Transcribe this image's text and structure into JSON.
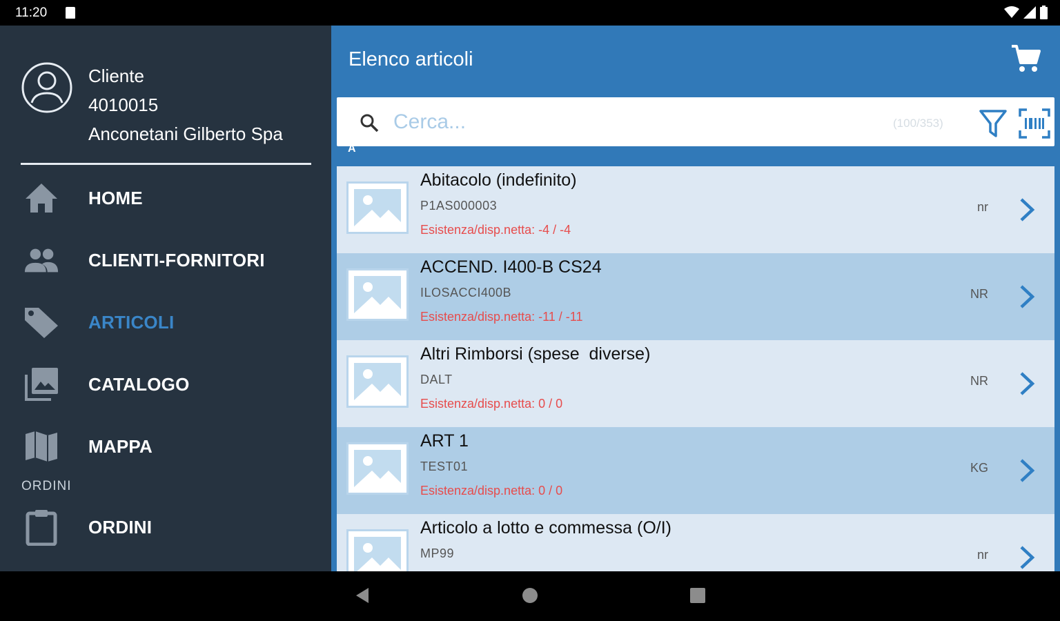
{
  "status_bar": {
    "time": "11:20"
  },
  "drawer": {
    "profile": {
      "label": "Cliente",
      "code": "4010015",
      "name": "Anconetani Gilberto Spa"
    },
    "menu": [
      {
        "label": "HOME",
        "icon": "home-icon"
      },
      {
        "label": "CLIENTI-FORNITORI",
        "icon": "people-icon"
      },
      {
        "label": "ARTICOLI",
        "icon": "tag-icon",
        "active": true
      },
      {
        "label": "CATALOGO",
        "icon": "photo-library-icon"
      },
      {
        "label": "MAPPA",
        "icon": "map-icon"
      }
    ],
    "section_ordini": "ORDINI",
    "menu_ordini": {
      "label": "ORDINI",
      "icon": "clipboard-icon"
    }
  },
  "app_bar": {
    "title": "Elenco articoli"
  },
  "search": {
    "placeholder": "Cerca...",
    "count": "(100/353)"
  },
  "section_letter": "A",
  "items": [
    {
      "title": "Abitacolo (indefinito)",
      "code": "P1AS000003",
      "stock": "Esistenza/disp.netta: -4 / -4",
      "unit": "nr"
    },
    {
      "title": "ACCEND. I400-B CS24",
      "code": "ILOSACCI400B",
      "stock": "Esistenza/disp.netta: -11 / -11",
      "unit": "NR"
    },
    {
      "title": "Altri Rimborsi (spese  diverse)",
      "code": "DALT",
      "stock": "Esistenza/disp.netta: 0 / 0",
      "unit": "NR"
    },
    {
      "title": "ART 1",
      "code": "TEST01",
      "stock": "Esistenza/disp.netta: 0 / 0",
      "unit": "KG"
    },
    {
      "title": "Articolo a lotto e commessa (O/I)",
      "code": "MP99",
      "stock": "",
      "unit": "nr"
    }
  ],
  "colors": {
    "drawer_bg": "#263340",
    "accent": "#3179b8",
    "active_menu": "#3a86c8",
    "stock_red": "#e74c4c"
  }
}
